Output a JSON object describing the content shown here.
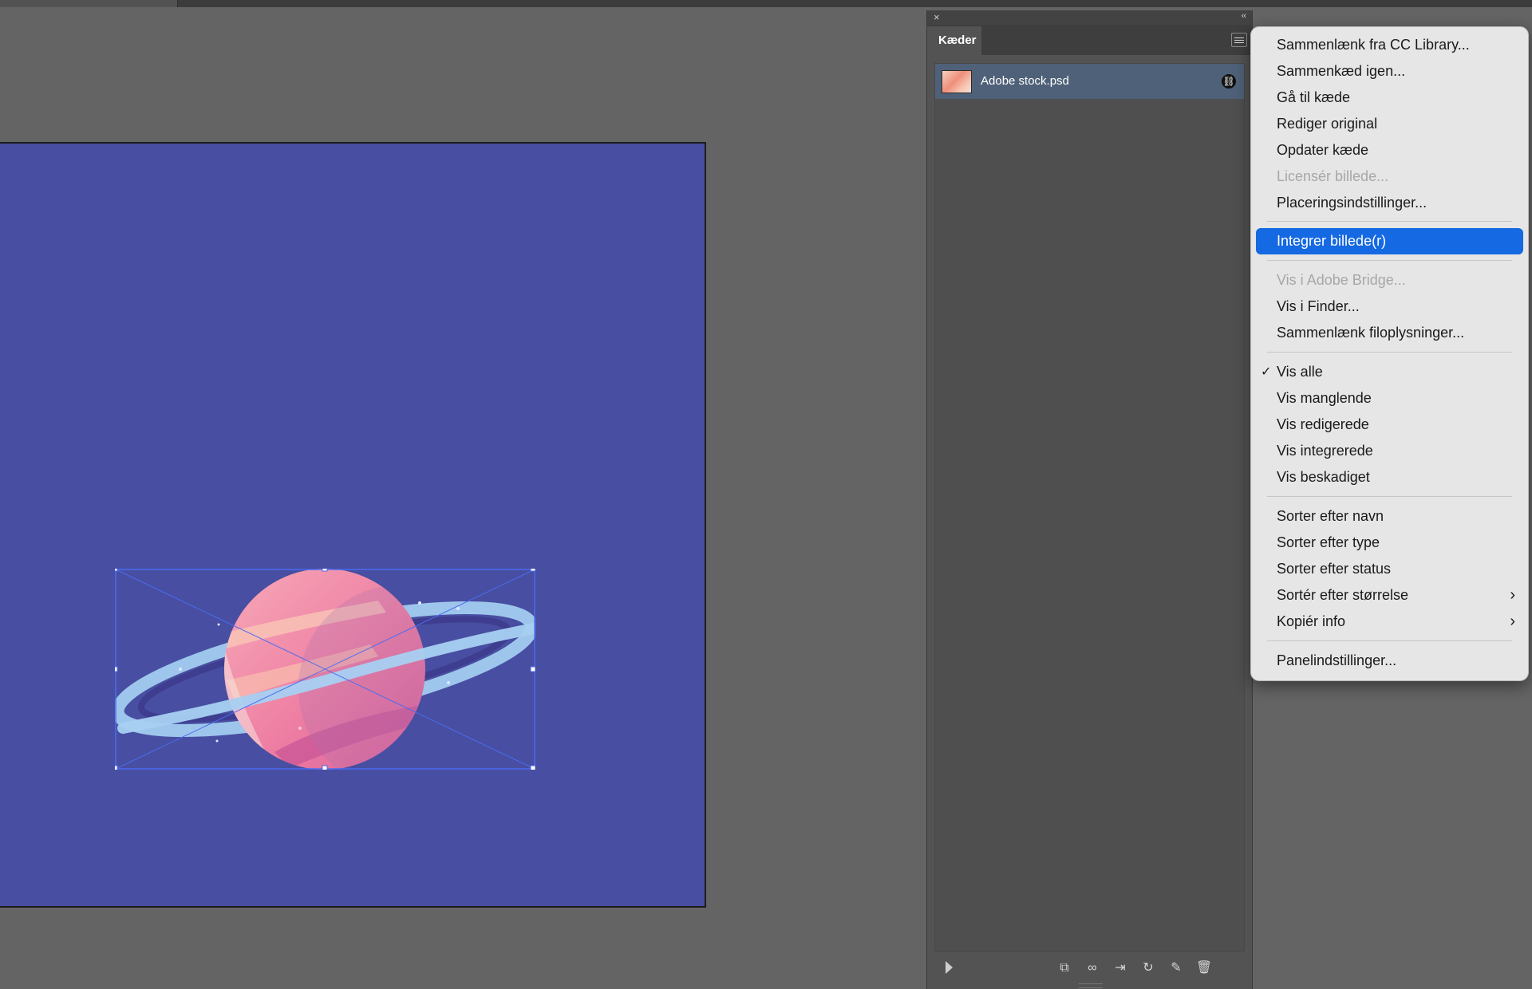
{
  "panel": {
    "tab_label": "Kæder",
    "close_glyph": "×",
    "collapse_glyph": "‹‹",
    "menu_icon": "hamburger-icon",
    "links": [
      {
        "name": "Adobe stock.psd",
        "badge_icon": "link-icon",
        "badge_glyph": "⛓"
      }
    ],
    "bottom_icons": [
      "play-icon",
      "cc-library-relink-icon",
      "relink-icon",
      "goto-link-icon",
      "update-link-icon",
      "edit-original-icon",
      "delete-icon"
    ]
  },
  "context_menu": {
    "items": [
      {
        "label": "Sammenlænk fra CC Library...",
        "state": "normal"
      },
      {
        "label": "Sammenkæd igen...",
        "state": "normal"
      },
      {
        "label": "Gå til kæde",
        "state": "normal"
      },
      {
        "label": "Rediger original",
        "state": "normal"
      },
      {
        "label": "Opdater kæde",
        "state": "normal"
      },
      {
        "label": "Licensér billede...",
        "state": "disabled"
      },
      {
        "label": "Placeringsindstillinger...",
        "state": "normal"
      },
      {
        "label": "Integrer billede(r)",
        "state": "highlighted"
      },
      {
        "label": "Vis i Adobe Bridge...",
        "state": "disabled"
      },
      {
        "label": "Vis i Finder...",
        "state": "normal"
      },
      {
        "label": "Sammenlænk filoplysninger...",
        "state": "normal"
      },
      {
        "label": "Vis alle",
        "state": "checked",
        "check": "✓"
      },
      {
        "label": "Vis manglende",
        "state": "normal"
      },
      {
        "label": "Vis redigerede",
        "state": "normal"
      },
      {
        "label": "Vis integrerede",
        "state": "normal"
      },
      {
        "label": "Vis beskadiget",
        "state": "normal"
      },
      {
        "label": "Sorter efter navn",
        "state": "normal"
      },
      {
        "label": "Sorter efter type",
        "state": "normal"
      },
      {
        "label": "Sorter efter status",
        "state": "normal"
      },
      {
        "label": "Sortér efter størrelse",
        "state": "submenu",
        "chev": "›"
      },
      {
        "label": "Kopiér info",
        "state": "submenu",
        "chev": "›"
      },
      {
        "label": "Panelindstillinger...",
        "state": "normal"
      }
    ]
  },
  "colors": {
    "artboard": "#484ea1",
    "selection": "#4b6cf0",
    "highlight": "#1569e2"
  }
}
